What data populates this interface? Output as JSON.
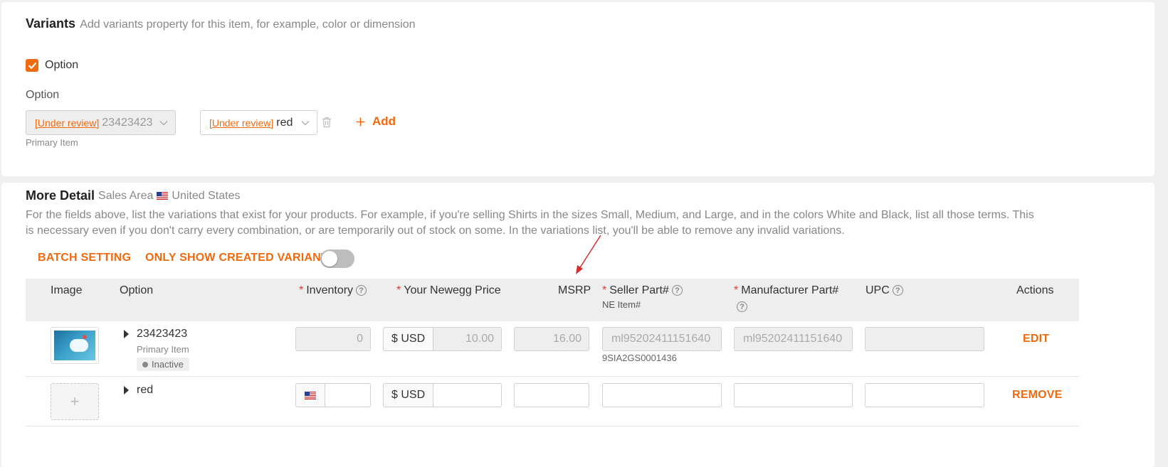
{
  "variants": {
    "title": "Variants",
    "subtitle": "Add variants property for this item, for example, color or dimension",
    "option_checkbox_label": "Option",
    "option_label": "Option",
    "selects": [
      {
        "review": "[Under review]",
        "value": "23423423"
      },
      {
        "review": "[Under review]",
        "value": "red"
      }
    ],
    "primary_item_note": "Primary Item",
    "add_label": "Add"
  },
  "detail": {
    "title": "More Detail",
    "sales_area_label": "Sales Area",
    "country": "United States",
    "description": "For the fields above, list the variations that exist for your products. For example, if you're selling Shirts in the sizes Small, Medium, and Large, and in the colors White and Black, list all those terms. This is necessary even if you don't carry every combination, or are temporarily out of stock on some. In the variations list, you'll be able to remove any invalid variations.",
    "batch_setting": "BATCH SETTING",
    "only_show_created": "ONLY SHOW CREATED VARIANTS",
    "toggle_on": false
  },
  "table": {
    "headers": {
      "image": "Image",
      "option": "Option",
      "inventory": "Inventory",
      "price": "Your Newegg Price",
      "msrp": "MSRP",
      "seller_part": "Seller Part#",
      "ne_item": "NE Item#",
      "manufacturer_part": "Manufacturer Part#",
      "upc": "UPC",
      "actions": "Actions"
    },
    "required_mark": "*",
    "help_mark": "?",
    "rows": [
      {
        "option": "23423423",
        "sub": "Primary Item",
        "status": "Inactive",
        "inventory": "0",
        "currency": "$ USD",
        "price": "10.00",
        "msrp": "16.00",
        "seller_part": "ml95202411151640",
        "ne_item": "9SIA2GS0001436",
        "manufacturer_part": "ml95202411151640",
        "upc": "",
        "action": "EDIT"
      },
      {
        "option": "red",
        "inventory": "",
        "currency": "$ USD",
        "price": "",
        "msrp": "",
        "seller_part": "",
        "manufacturer_part": "",
        "upc": "",
        "action": "REMOVE"
      }
    ]
  },
  "colors": {
    "accent": "#f06a0f",
    "required": "#e53935"
  }
}
